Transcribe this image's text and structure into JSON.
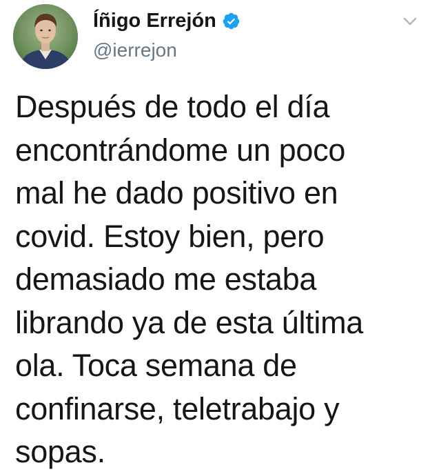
{
  "author": {
    "display_name": "Íñigo Errejón",
    "handle": "@ierrejon",
    "verified": true,
    "avatar_icon": "profile-photo"
  },
  "menu": {
    "icon": "chevron-down-icon"
  },
  "tweet": {
    "lines": [
      "Después de todo el día",
      "encontrándome un poco",
      "mal he dado positivo en",
      "covid. Estoy bien, pero",
      "demasiado me estaba",
      "librando ya de esta última",
      "ola. Toca semana de",
      "confinarse, teletrabajo y",
      "sopas."
    ]
  },
  "colors": {
    "text": "#14171a",
    "secondary": "#657786",
    "verified": "#1da1f2"
  }
}
